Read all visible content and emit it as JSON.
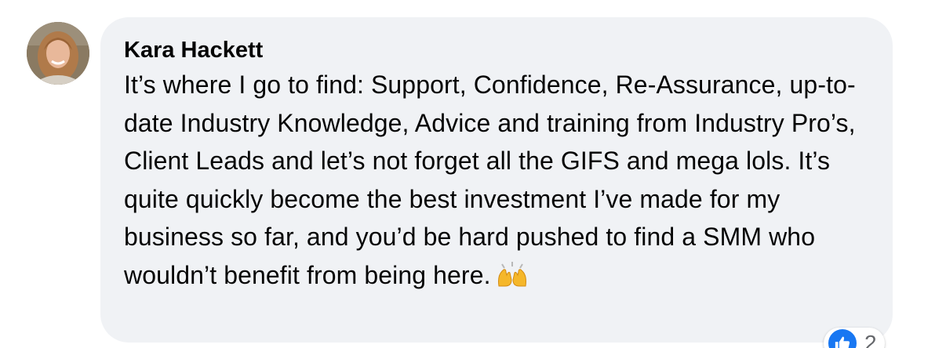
{
  "comment": {
    "author": "Kara Hackett",
    "text": "It’s where I go to find: Support, Confidence, Re-Assurance, up-to-date Industry Knowledge, Advice and training from Industry Pro’s, Client Leads and let’s not forget all the GIFS and mega lols. It’s quite quickly become the best investment I’ve made for my business so far, and you’d be hard pushed to find a SMM who wouldn’t benefit from being here.",
    "emoji": "raising-hands-emoji"
  },
  "reactions": {
    "icon": "like-icon",
    "count": "2"
  },
  "colors": {
    "bubble": "#f0f2f5",
    "text": "#050505",
    "like_blue": "#1877f2",
    "count_gray": "#65676b"
  }
}
